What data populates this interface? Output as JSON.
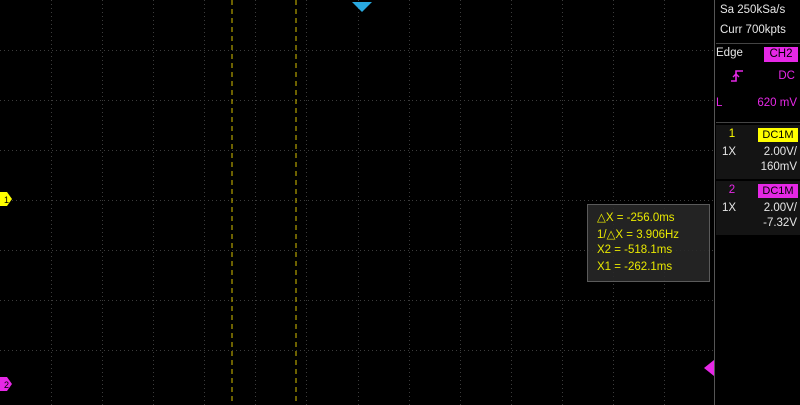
{
  "acquisition": {
    "sample_rate": "Sa 250kSa/s",
    "memory_depth": "Curr 700kpts"
  },
  "trigger": {
    "type_label": "Edge",
    "source": "CH2",
    "slope_icon": "rising-edge-icon",
    "coupling": "DC",
    "level_prefix": "L",
    "level": "620 mV"
  },
  "channels": [
    {
      "number": "1",
      "coupling": "DC1M",
      "probe": "1X",
      "scale": "2.00V/",
      "offset": "160mV",
      "color": "#ffff00"
    },
    {
      "number": "2",
      "coupling": "DC1M",
      "probe": "1X",
      "scale": "2.00V/",
      "offset": "-7.32V",
      "color": "#e628e6"
    }
  ],
  "markers": {
    "ch1_ground": "1",
    "ch2_ground": "2"
  },
  "cursors": {
    "delta_x": "△X = -256.0ms",
    "inv_delta_x": "1/△X = 3.906Hz",
    "x2": "X2 = -518.1ms",
    "x1": "X1 = -262.1ms"
  },
  "colors": {
    "ch1": "#ffff00",
    "ch2": "#e628e6",
    "trigger_marker": "#29a9e0",
    "cursor": "#e8e800",
    "grid": "#3c3c3c"
  }
}
